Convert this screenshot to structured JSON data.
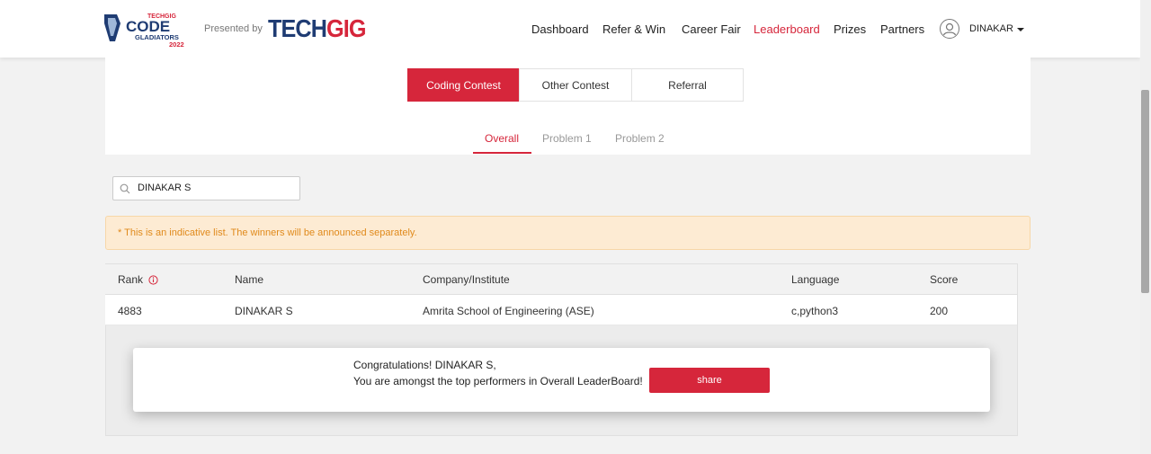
{
  "header": {
    "logo_brand_small": "TECHGIG",
    "logo_code": "CODE",
    "logo_gladiators": "GLADIATORS",
    "logo_year": "2022",
    "presented_by": "Presented by",
    "techgig_part1": "TECH",
    "techgig_part2": "GIG",
    "nav": [
      {
        "label": "Dashboard",
        "active": false
      },
      {
        "label": "Refer & Win",
        "active": false
      },
      {
        "label": "Career Fair",
        "active": false
      },
      {
        "label": "Leaderboard",
        "active": true
      },
      {
        "label": "Prizes",
        "active": false
      },
      {
        "label": "Partners",
        "active": false
      }
    ],
    "user": "DINAKAR"
  },
  "tabs": [
    {
      "label": "Coding Contest",
      "active": true
    },
    {
      "label": "Other Contest",
      "active": false
    },
    {
      "label": "Referral",
      "active": false
    }
  ],
  "subtabs": [
    {
      "label": "Overall",
      "active": true
    },
    {
      "label": "Problem 1",
      "active": false
    },
    {
      "label": "Problem 2",
      "active": false
    }
  ],
  "search": {
    "value": "DINAKAR S"
  },
  "notice": "* This is an indicative list. The winners will be announced separately.",
  "table": {
    "headers": [
      "Rank",
      "Name",
      "Company/Institute",
      "Language",
      "Score"
    ],
    "rows": [
      [
        "4883",
        "DINAKAR S",
        "Amrita School of Engineering (ASE)",
        "c,python3",
        "200"
      ]
    ]
  },
  "popup": {
    "line1": "Congratulations! DINAKAR S,",
    "line2": "You are amongst the top performers in Overall LeaderBoard!",
    "share_label": "share"
  },
  "colors": {
    "accent": "#d6263b",
    "brand_blue": "#1f3c73",
    "notice_text": "#e08a1c",
    "notice_bg": "#fdebd3"
  }
}
